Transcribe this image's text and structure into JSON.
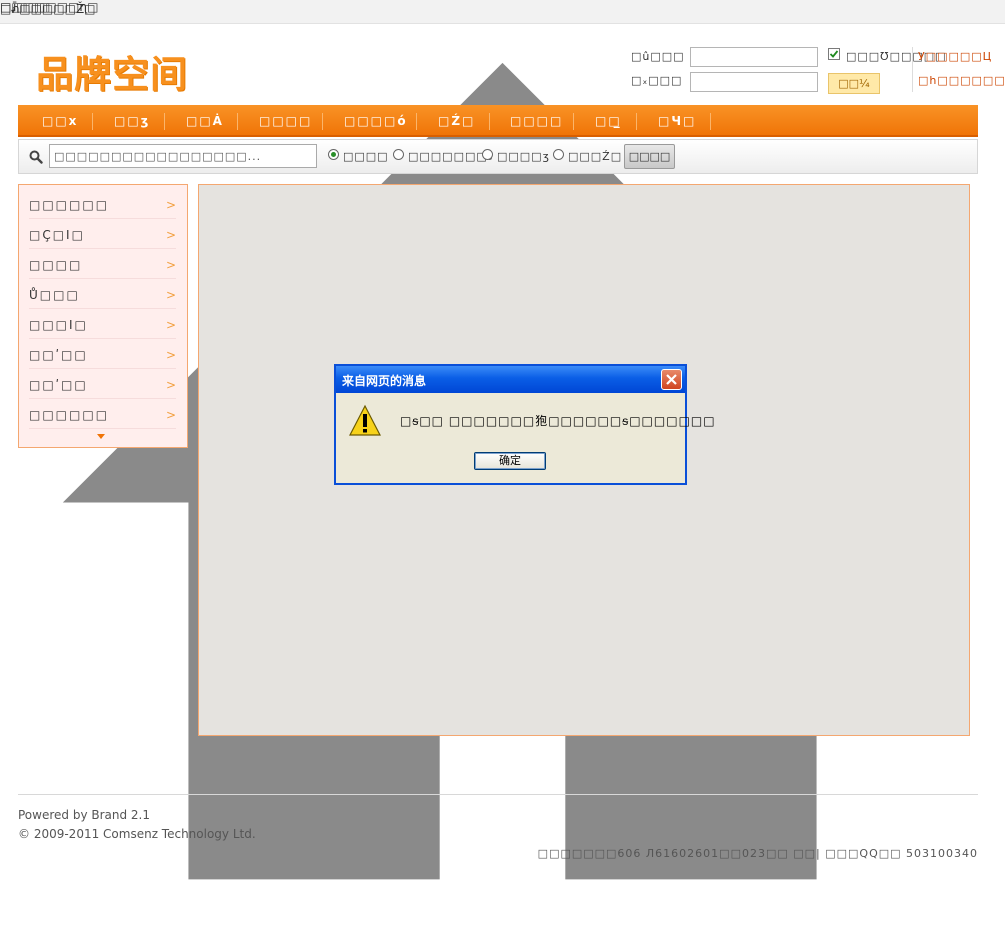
{
  "topbar": {
    "home_label": "□ɹ̄□□̣□",
    "favorite_label": "□□□□□□□ɳ□",
    "right_link": "□ภ□□□□□Ž□"
  },
  "brand": {
    "logo_text": "品牌空间"
  },
  "login": {
    "username_label": "□û□□□",
    "password_label": "□ₓ□□□",
    "remember_label": "□□□Ʊ□□□□□",
    "submit_label": "□□¼",
    "register_link": "У□□□□□Ц",
    "forgot_link": "□h□□□□□□"
  },
  "nav": {
    "items": [
      "□□x",
      "□□ʒ",
      "□□Ȧ",
      "□□□□",
      "□□□□ό",
      "□Ź□",
      "□□□□",
      "□□̲",
      "□Ч□"
    ]
  },
  "search": {
    "input_value": "□□□□□□□□□□□□□□□□□...",
    "options": [
      "□□□□",
      "□□□□□□□₀",
      "□□□□ʒ",
      "□□□Ź□"
    ],
    "selected_index": 0,
    "button_label": "□□□□"
  },
  "sidebar": {
    "items": [
      {
        "label": "□□□□□□",
        "arrow": ">"
      },
      {
        "label": "□Ҫ□Ι□",
        "arrow": ">"
      },
      {
        "label": "□□□□",
        "arrow": ">"
      },
      {
        "label": "Ů□□□",
        "arrow": ">"
      },
      {
        "label": "□□□Ι□",
        "arrow": ">"
      },
      {
        "label": "□□ʹ□□",
        "arrow": ">"
      },
      {
        "label": "□□ʹ□□",
        "arrow": ">"
      },
      {
        "label": "□□□□□□",
        "arrow": ">"
      }
    ]
  },
  "dialog": {
    "title": "来自网页的消息",
    "message": "□ᵴ□□ □□□□□□□狍□□□□□□ᵴ□□□□□□□",
    "ok_label": "确定"
  },
  "footer": {
    "powered": "Powered by Brand 2.1",
    "copyright": "© 2009-2011 Comsenz Technology Ltd.",
    "icp": "□□□□□□□606 Л61602601□□023□□ □□| □□□QQ□□ 503100340"
  },
  "colors": {
    "accent": "#f07407",
    "logo": "#f7901e",
    "dialog_title": "#0a5ee6"
  }
}
